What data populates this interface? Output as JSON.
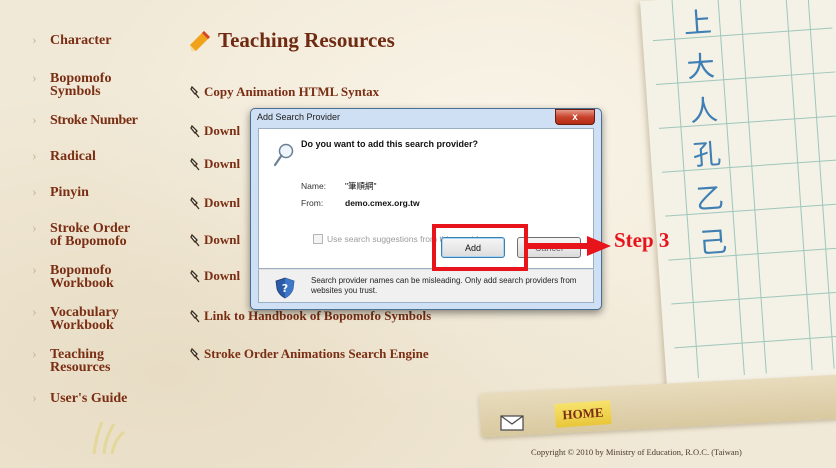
{
  "sidebar": {
    "items": [
      {
        "label": "Character"
      },
      {
        "label": "Bopomofo\nSymbols"
      },
      {
        "label": "Stroke Number"
      },
      {
        "label": "Radical"
      },
      {
        "label": "Pinyin"
      },
      {
        "label": "Stroke Order\nof Bopomofo"
      },
      {
        "label": "Bopomofo\nWorkbook"
      },
      {
        "label": "Vocabulary\nWorkbook"
      },
      {
        "label": "Teaching\nResources"
      },
      {
        "label": "User's Guide"
      }
    ]
  },
  "main": {
    "heading": "Teaching Resources",
    "links": [
      {
        "label": "Copy Animation HTML Syntax"
      },
      {
        "label": "Downl"
      },
      {
        "label": "Downl"
      },
      {
        "label": "Downl"
      },
      {
        "label": "Downl"
      },
      {
        "label": "Downl"
      },
      {
        "label": "Link to Handbook of Bopomofo Symbols"
      },
      {
        "label": "Stroke Order Animations Search Engine"
      }
    ]
  },
  "notebook": {
    "chars": [
      "上",
      "大",
      "人",
      "孔",
      "乙",
      "己"
    ]
  },
  "footer": {
    "home_label": "HOME",
    "copyright": "Copyright © 2010 by Ministry of Education, R.O.C. (Taiwan)"
  },
  "dialog": {
    "title": "Add Search Provider",
    "close_label": "x",
    "question": "Do you want to add this search provider?",
    "name_label": "Name:",
    "name_value": "\"筆順網\"",
    "from_label": "From:",
    "from_value": "demo.cmex.org.tw",
    "checkbox_label": "Use search suggestions from this provider",
    "add_label": "Add",
    "cancel_label": "Cancel",
    "warning": "Search provider names can be misleading. Only add search providers from websites you trust."
  },
  "annotation": {
    "step_label": "Step 3",
    "color": "#e8141c"
  }
}
